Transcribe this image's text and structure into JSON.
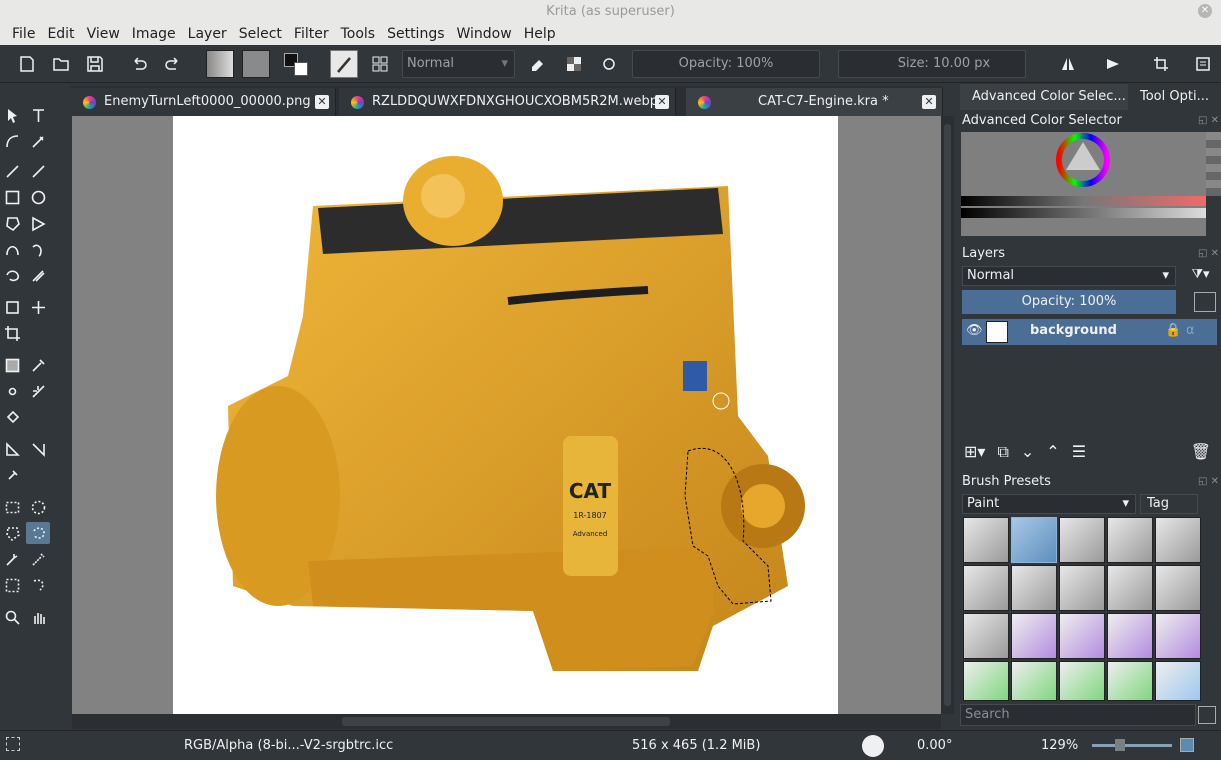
{
  "window": {
    "title": "Krita (as superuser)"
  },
  "menu": [
    "File",
    "Edit",
    "View",
    "Image",
    "Layer",
    "Select",
    "Filter",
    "Tools",
    "Settings",
    "Window",
    "Help"
  ],
  "toolbar": {
    "blend_mode": "Normal",
    "opacity": "Opacity: 100%",
    "size": "Size: 10.00 px"
  },
  "tabs": [
    {
      "label": "EnemyTurnLeft0000_00000.png *"
    },
    {
      "label": "RZLDDQUWXFDNXGHOUCXOBM5R2M.webp *"
    },
    {
      "label": "CAT-C7-Engine.kra *"
    }
  ],
  "right_tabs": [
    "Advanced Color Selec...",
    "Tool Opti..."
  ],
  "color_selector": {
    "title": "Advanced Color Selector"
  },
  "layers": {
    "title": "Layers",
    "blend_mode": "Normal",
    "opacity": "Opacity:  100%",
    "items": [
      {
        "name": "background"
      }
    ]
  },
  "brush_presets": {
    "title": "Brush Presets",
    "category": "Paint",
    "tag_label": "Tag",
    "search_placeholder": "Search"
  },
  "engine_decal": {
    "brand": "CAT",
    "filter_text": "1R-1807",
    "filter_sub": "Advanced"
  },
  "status": {
    "color_profile": "RGB/Alpha (8-bi...-V2-srgbtrc.icc",
    "image_size": "516 x 465 (1.2 MiB)",
    "rotation": "0.00°",
    "zoom": "129%"
  },
  "colors": {
    "accent": "#4a6e95",
    "engine": "#e8a92a",
    "panel": "#31363b"
  }
}
